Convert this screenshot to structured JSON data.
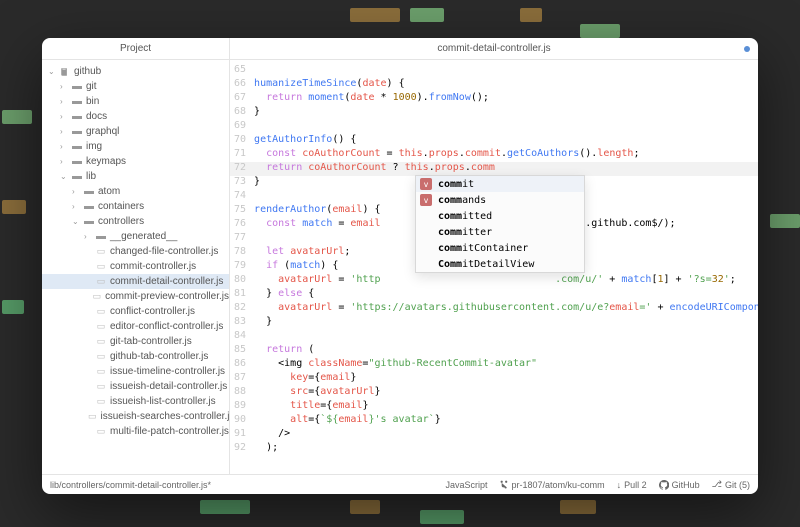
{
  "titlebar": {
    "project_label": "Project",
    "tab_label": "commit-detail-controller.js"
  },
  "tree": {
    "root": "github",
    "folders_level1": [
      "git",
      "bin",
      "docs",
      "graphql",
      "img",
      "keymaps"
    ],
    "lib": "lib",
    "lib_children": [
      "atom",
      "containers"
    ],
    "controllers": "controllers",
    "generated": "__generated__",
    "files": [
      "changed-file-controller.js",
      "commit-controller.js",
      "commit-detail-controller.js",
      "commit-preview-controller.js",
      "conflict-controller.js",
      "editor-conflict-controller.js",
      "git-tab-controller.js",
      "github-tab-controller.js",
      "issue-timeline-controller.js",
      "issueish-detail-controller.js",
      "issueish-list-controller.js",
      "issueish-searches-controller.js",
      "multi-file-patch-controller.js"
    ],
    "selected_file": "commit-detail-controller.js"
  },
  "gutter": {
    "start": 65,
    "end": 92
  },
  "code": {
    "lines": [
      "",
      "humanizeTimeSince(date) {",
      "  return moment(date * 1000).fromNow();",
      "}",
      "",
      "getAuthorInfo() {",
      "  const coAuthorCount = this.props.commit.getCoAuthors().length;",
      "  return coAuthorCount ? this.props.comm",
      "}",
      "",
      "renderAuthor(email) {",
      "  const match = email                           noreply.github.com$/);",
      "",
      "  let avatarUrl;",
      "  if (match) {",
      "    avatarUrl = 'http                             .com/u/' + match[1] + '?s=32';",
      "  } else {",
      "    avatarUrl = 'https://avatars.githubusercontent.com/u/e?email=' + encodeURIComponen",
      "  }",
      "",
      "  return (",
      "    <img className=\"github-RecentCommit-avatar\"",
      "      key={email}",
      "      src={avatarUrl}",
      "      title={email}",
      "      alt={`${email}'s avatar`}",
      "    />",
      "  );"
    ]
  },
  "autocomplete": {
    "items": [
      {
        "badge": "v",
        "prefix": "comm",
        "rest": "it"
      },
      {
        "badge": "v",
        "prefix": "comm",
        "rest": "ands"
      },
      {
        "badge": "",
        "prefix": "comm",
        "rest": "itted"
      },
      {
        "badge": "",
        "prefix": "comm",
        "rest": "itter"
      },
      {
        "badge": "",
        "prefix": "comm",
        "rest": "itContainer"
      },
      {
        "badge": "",
        "prefix": "Comm",
        "rest": "itDetailView"
      }
    ]
  },
  "statusbar": {
    "path": "lib/controllers/commit-detail-controller.js*",
    "language": "JavaScript",
    "branch": "pr-1807/atom/ku-comm",
    "pull": "Pull 2",
    "github": "GitHub",
    "git": "Git (5)"
  }
}
